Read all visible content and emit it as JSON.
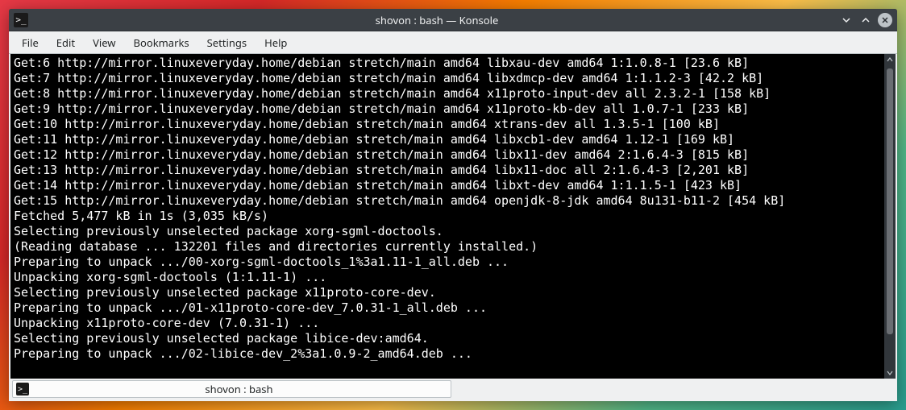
{
  "window": {
    "title": "shovon : bash — Konsole",
    "icon_glyph": ">_"
  },
  "menubar": {
    "items": [
      "File",
      "Edit",
      "View",
      "Bookmarks",
      "Settings",
      "Help"
    ]
  },
  "terminal": {
    "lines": [
      "Get:6 http://mirror.linuxeveryday.home/debian stretch/main amd64 libxau-dev amd64 1:1.0.8-1 [23.6 kB]",
      "Get:7 http://mirror.linuxeveryday.home/debian stretch/main amd64 libxdmcp-dev amd64 1:1.1.2-3 [42.2 kB]",
      "Get:8 http://mirror.linuxeveryday.home/debian stretch/main amd64 x11proto-input-dev all 2.3.2-1 [158 kB]",
      "Get:9 http://mirror.linuxeveryday.home/debian stretch/main amd64 x11proto-kb-dev all 1.0.7-1 [233 kB]",
      "Get:10 http://mirror.linuxeveryday.home/debian stretch/main amd64 xtrans-dev all 1.3.5-1 [100 kB]",
      "Get:11 http://mirror.linuxeveryday.home/debian stretch/main amd64 libxcb1-dev amd64 1.12-1 [169 kB]",
      "Get:12 http://mirror.linuxeveryday.home/debian stretch/main amd64 libx11-dev amd64 2:1.6.4-3 [815 kB]",
      "Get:13 http://mirror.linuxeveryday.home/debian stretch/main amd64 libx11-doc all 2:1.6.4-3 [2,201 kB]",
      "Get:14 http://mirror.linuxeveryday.home/debian stretch/main amd64 libxt-dev amd64 1:1.1.5-1 [423 kB]",
      "Get:15 http://mirror.linuxeveryday.home/debian stretch/main amd64 openjdk-8-jdk amd64 8u131-b11-2 [454 kB]",
      "Fetched 5,477 kB in 1s (3,035 kB/s)",
      "Selecting previously unselected package xorg-sgml-doctools.",
      "(Reading database ... 132201 files and directories currently installed.)",
      "Preparing to unpack .../00-xorg-sgml-doctools_1%3a1.11-1_all.deb ...",
      "Unpacking xorg-sgml-doctools (1:1.11-1) ...",
      "Selecting previously unselected package x11proto-core-dev.",
      "Preparing to unpack .../01-x11proto-core-dev_7.0.31-1_all.deb ...",
      "Unpacking x11proto-core-dev (7.0.31-1) ...",
      "Selecting previously unselected package libice-dev:amd64.",
      "Preparing to unpack .../02-libice-dev_2%3a1.0.9-2_amd64.deb ..."
    ]
  },
  "tabs": {
    "items": [
      {
        "label": "shovon : bash",
        "icon_glyph": ">_"
      }
    ]
  }
}
